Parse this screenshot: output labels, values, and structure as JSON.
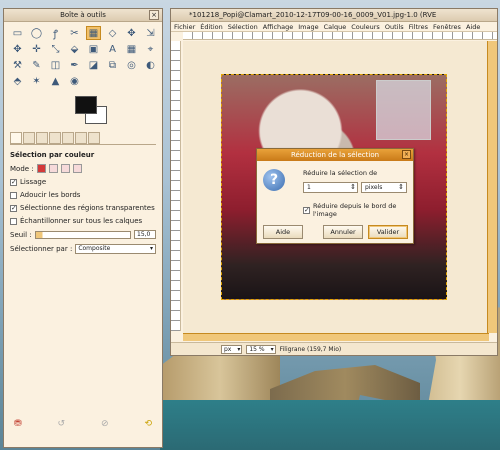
{
  "toolbox": {
    "title": "Boîte à outils",
    "close": "×",
    "tools": [
      "▭",
      "◯",
      "ꝭ",
      "✂",
      "▦",
      "◇",
      "✥",
      "⇲",
      "✥",
      "✛",
      "⤡",
      "⬙",
      "▣",
      "A",
      "▦",
      "⌖",
      "⚒",
      "✎",
      "◫",
      "✒",
      "◪",
      "⧉",
      "◎",
      "◐",
      "⬘",
      "✶",
      "▲",
      "◉"
    ],
    "panel_title": "Sélection par couleur",
    "mode_label": "Mode :",
    "options": [
      {
        "label": "Lissage",
        "checked": true
      },
      {
        "label": "Adoucir les bords",
        "checked": false
      },
      {
        "label": "Sélectionne des régions transparentes",
        "checked": true
      },
      {
        "label": "Échantillonner sur tous les calques",
        "checked": false
      }
    ],
    "threshold_label": "Seuil :",
    "threshold_value": "15,0",
    "select_by_label": "Sélectionner par :",
    "select_by_value": "Composite"
  },
  "image_window": {
    "title": "*101218_Popi@Clamart_2010-12-17T09-00-16_0009_V01.jpg-1.0 (RVE",
    "menu": [
      "Fichier",
      "Édition",
      "Sélection",
      "Affichage",
      "Image",
      "Calque",
      "Couleurs",
      "Outils",
      "Filtres",
      "Fenêtres",
      "Aide"
    ],
    "unit": "px",
    "zoom": "15 %",
    "status": "Filigrane (159,7 Mio)"
  },
  "dialog": {
    "title": "Réduction de la sélection",
    "close": "×",
    "label": "Réduire la sélection de",
    "value": "1",
    "unit": "pixels",
    "checkbox_label": "Réduire depuis le bord de l'image",
    "help": "Aide",
    "cancel": "Annuler",
    "ok": "Valider"
  }
}
